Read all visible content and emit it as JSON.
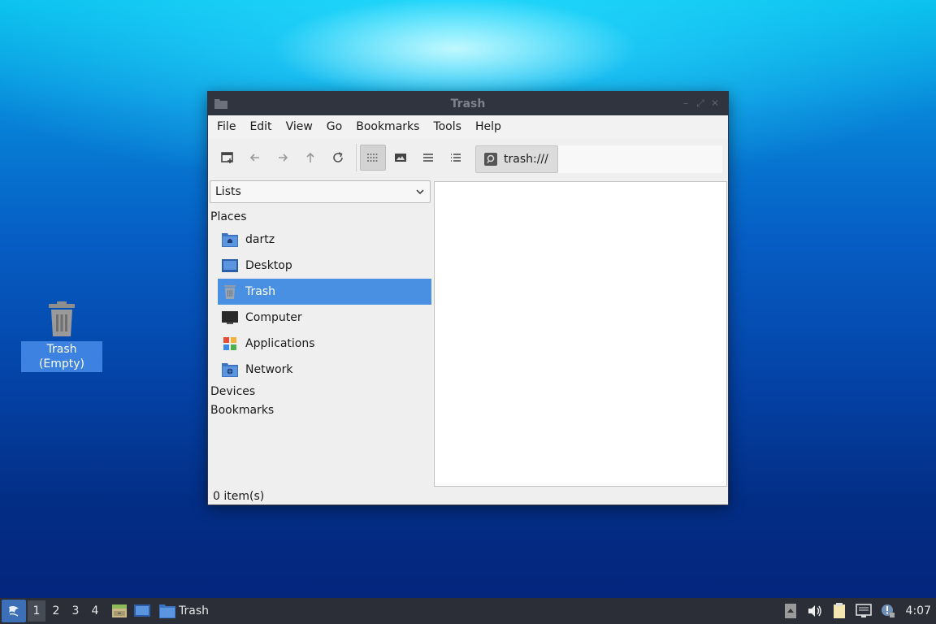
{
  "desktop": {
    "trash_icon_label": "Trash (Empty)"
  },
  "window": {
    "title": "Trash",
    "menu": [
      "File",
      "Edit",
      "View",
      "Go",
      "Bookmarks",
      "Tools",
      "Help"
    ],
    "toolbar": {
      "buttons": [
        "new-tab-icon",
        "back-icon",
        "forward-icon",
        "up-icon",
        "reload-icon",
        "icon-view-icon",
        "thumbnail-view-icon",
        "compact-view-icon",
        "detailed-list-icon"
      ],
      "active_view": "icon-view-icon"
    },
    "path": "trash:///",
    "sidepane": {
      "mode": "Lists",
      "sections": {
        "places": "Places",
        "devices": "Devices",
        "bookmarks": "Bookmarks"
      },
      "places": [
        {
          "label": "dartz",
          "icon": "home-folder-icon"
        },
        {
          "label": "Desktop",
          "icon": "desktop-icon"
        },
        {
          "label": "Trash",
          "icon": "trash-icon",
          "selected": true
        },
        {
          "label": "Computer",
          "icon": "computer-icon"
        },
        {
          "label": "Applications",
          "icon": "applications-icon"
        },
        {
          "label": "Network",
          "icon": "network-folder-icon"
        }
      ]
    },
    "status": "0 item(s)"
  },
  "taskbar": {
    "workspaces": [
      "1",
      "2",
      "3",
      "4"
    ],
    "active_workspace": "1",
    "task_label": "Trash",
    "clock": "4:07"
  },
  "colors": {
    "selection": "#4a90e2",
    "titlebar": "#2f343f",
    "taskbar": "#2b2e37"
  }
}
